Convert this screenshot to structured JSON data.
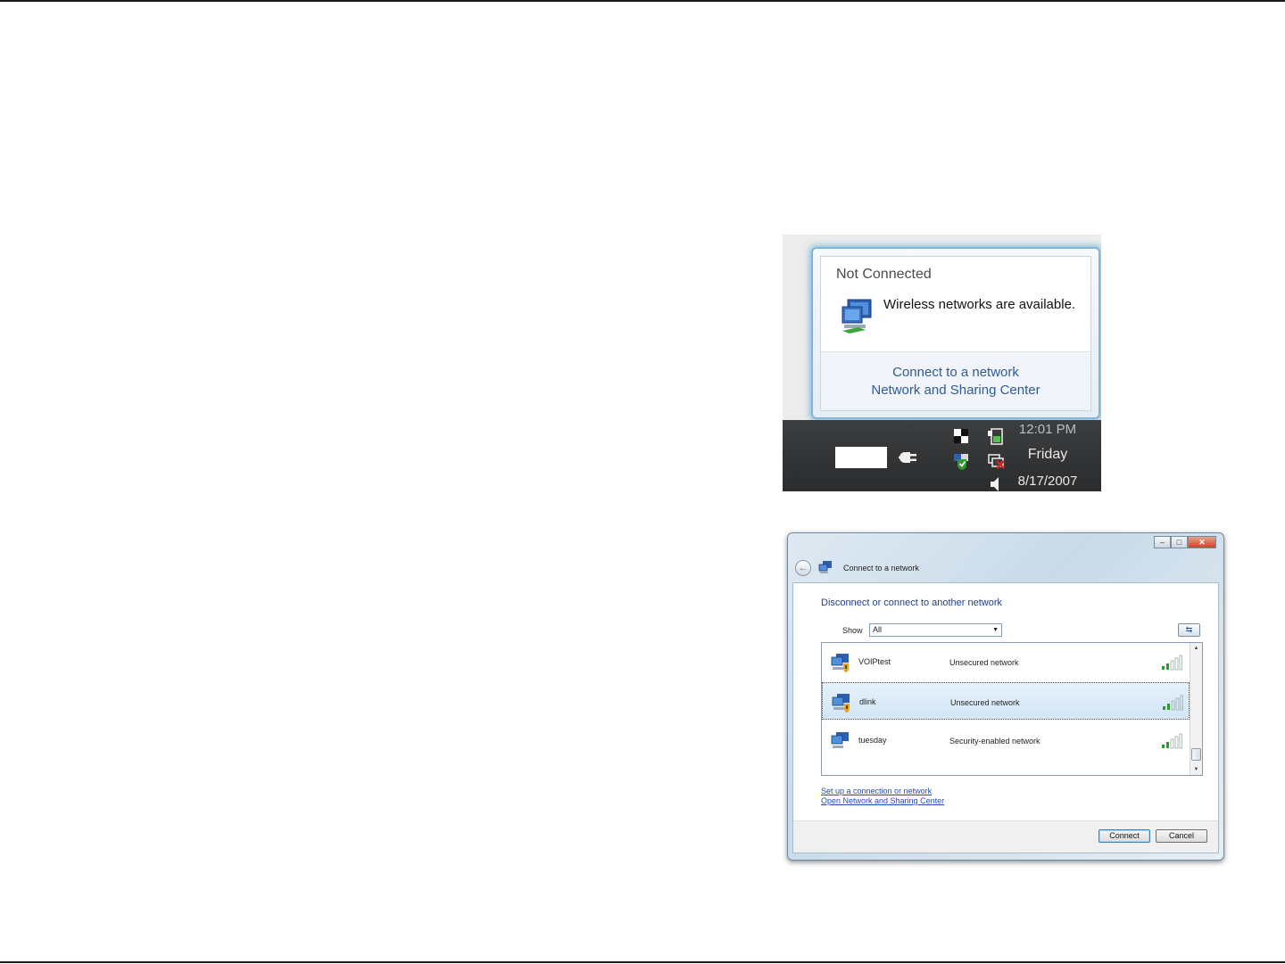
{
  "balloon": {
    "title": "Not Connected",
    "message": "Wireless networks are available.",
    "links": [
      "Connect to a network",
      "Network and Sharing Center"
    ]
  },
  "tray": {
    "time": "12:01 PM",
    "day": "Friday",
    "date": "8/17/2007"
  },
  "window": {
    "title": "Connect to a network",
    "heading": "Disconnect or connect to another network",
    "show_label": "Show",
    "show_value": "All",
    "networks": [
      {
        "name": "VOIPtest",
        "status": "Unsecured network"
      },
      {
        "name": "dlink",
        "status": "Unsecured network"
      },
      {
        "name": "tuesday",
        "status": "Security-enabled network"
      }
    ],
    "links": [
      "Set up a connection or network",
      "Open Network and Sharing Center"
    ],
    "connect_label": "Connect",
    "cancel_label": "Cancel"
  },
  "colors": {
    "link": "#1c4fb3",
    "heading": "#1e3f8a",
    "balloon_glow": "#7fb6d6",
    "taskbar": "#2a2c2e",
    "selected_row": "#d3e6f6",
    "close_button": "#c8452c",
    "signal_green": "#2f9a2f"
  }
}
